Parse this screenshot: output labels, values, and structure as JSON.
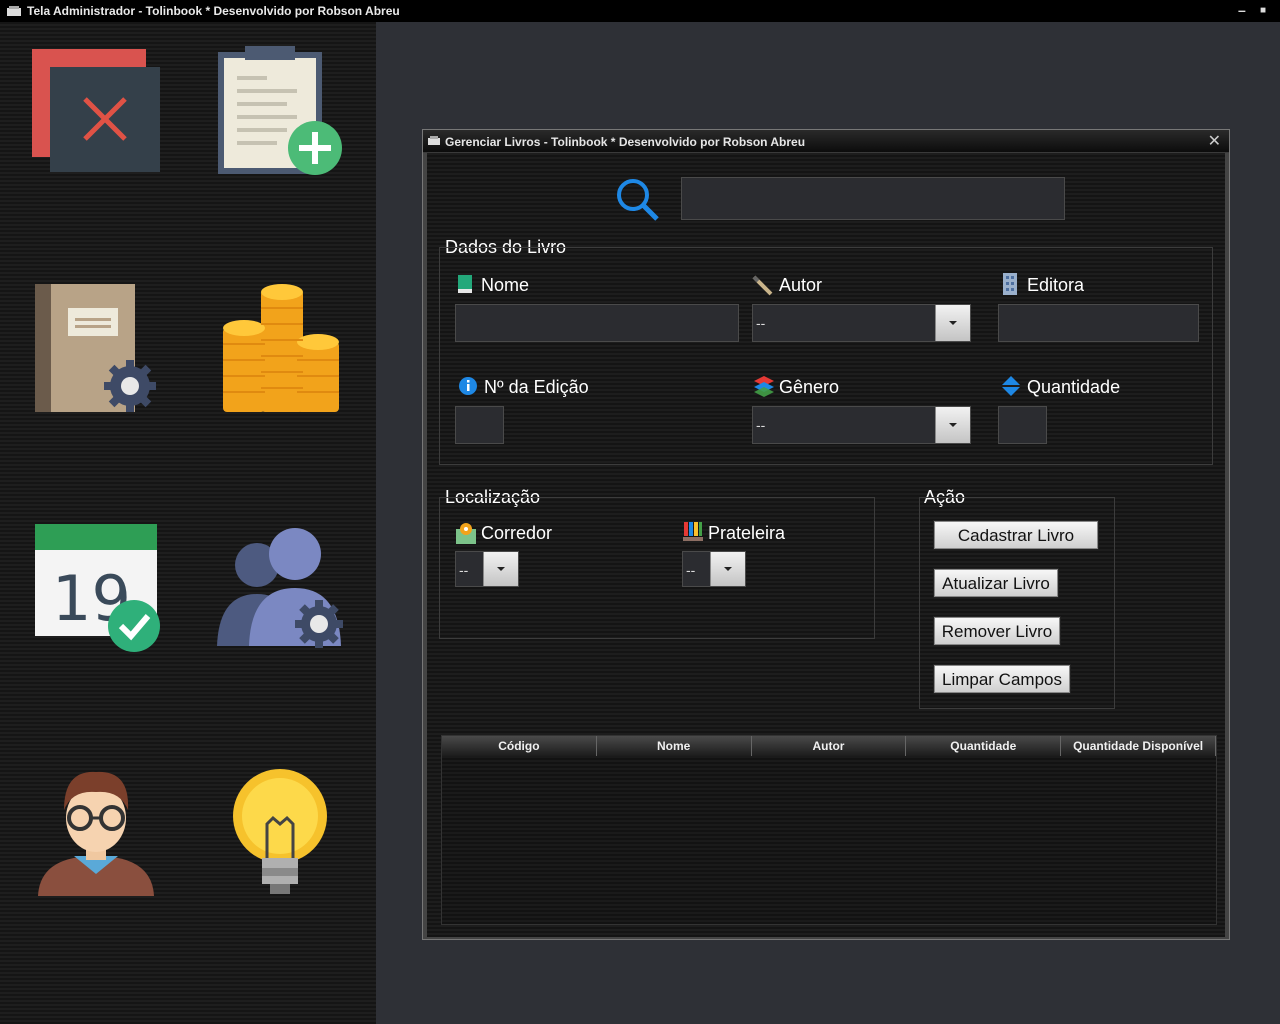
{
  "window": {
    "title": "Tela Administrador - Tolinbook * Desenvolvido por Robson Abreu",
    "minimize": "–",
    "maximize": "■"
  },
  "sidebar": {
    "tiles": [
      {
        "name": "exit-icon"
      },
      {
        "name": "add-book-clipboard-icon"
      },
      {
        "name": "manage-books-icon"
      },
      {
        "name": "coins-icon"
      },
      {
        "name": "calendar-check-icon",
        "day": "19"
      },
      {
        "name": "manage-users-icon"
      },
      {
        "name": "user-profile-icon"
      },
      {
        "name": "lightbulb-icon"
      }
    ]
  },
  "inner_window": {
    "title": "Gerenciar Livros - Tolinbook * Desenvolvido por Robson Abreu",
    "close": "✕"
  },
  "search": {
    "value": ""
  },
  "dados_livro": {
    "section": "Dados do Livro",
    "nome_label": "Nome",
    "autor_label": "Autor",
    "autor_value": "--",
    "editora_label": "Editora",
    "edicao_label": "Nº da Edição",
    "genero_label": "Gênero",
    "genero_value": "--",
    "quantidade_label": "Quantidade"
  },
  "localizacao": {
    "section": "Localização",
    "corredor_label": "Corredor",
    "corredor_value": "--",
    "prateleira_label": "Prateleira",
    "prateleira_value": "--"
  },
  "acao": {
    "section": "Ação",
    "cadastrar": "Cadastrar Livro",
    "atualizar": "Atualizar Livro",
    "remover": "Remover Livro",
    "limpar": "Limpar Campos"
  },
  "table": {
    "columns": [
      "Código",
      "Nome",
      "Autor",
      "Quantidade",
      "Quantidade Disponível"
    ],
    "rows": []
  }
}
